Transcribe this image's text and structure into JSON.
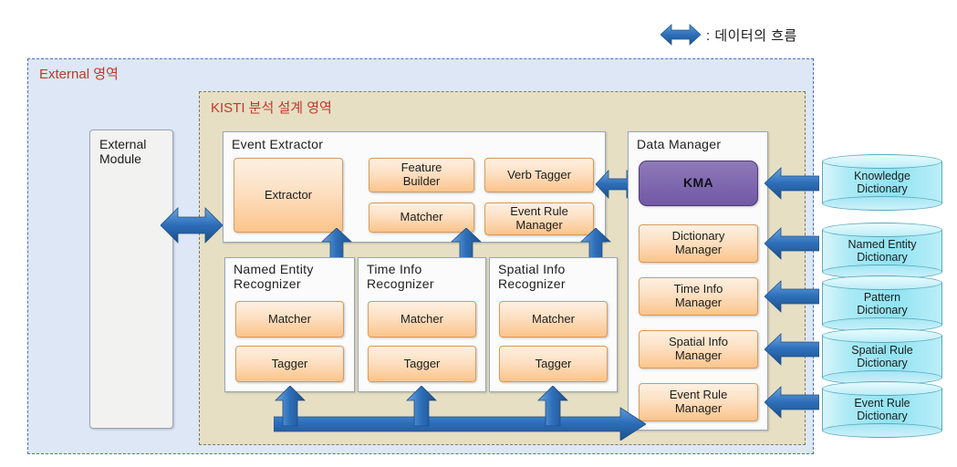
{
  "legend": {
    "icon": "double-headed-arrow-icon",
    "text": ": 데이터의 흐름"
  },
  "regions": {
    "external": {
      "label": "External 영역",
      "fill": "#dde7f5",
      "border": "#4a72b8"
    },
    "kisti": {
      "label": "KISTI 분석 설계 영역",
      "fill": "#e6dfc4",
      "border": "#7a7a6a"
    }
  },
  "colors": {
    "orange_box": "#fbc48b",
    "purple_box": "#7158a5",
    "cylinder": "#8fe3f2",
    "arrow_blue": "#2e6fba",
    "label_red": "#c0392b"
  },
  "external_module": {
    "label": "External\nModule",
    "line1": "External",
    "line2": "Module"
  },
  "panels": {
    "event_extractor": {
      "title": "Event  Extractor",
      "boxes": [
        {
          "label": "Extractor"
        },
        {
          "line1": "Feature",
          "line2": "Builder"
        },
        {
          "line1": "Verb Tagger",
          "line2": ""
        },
        {
          "line1": "Matcher",
          "line2": ""
        },
        {
          "line1": "Event Rule",
          "line2": "Manager"
        }
      ]
    },
    "named_entity_recognizer": {
      "title_line1": "Named  Entity",
      "title_line2": "Recognizer",
      "boxes": [
        {
          "label": "Matcher"
        },
        {
          "label": "Tagger"
        }
      ]
    },
    "time_info_recognizer": {
      "title_line1": "Time Info",
      "title_line2": "Recognizer",
      "boxes": [
        {
          "label": "Matcher"
        },
        {
          "label": "Tagger"
        }
      ]
    },
    "spatial_info_recognizer": {
      "title_line1": "Spatial Info",
      "title_line2": "Recognizer",
      "boxes": [
        {
          "label": "Matcher"
        },
        {
          "label": "Tagger"
        }
      ]
    },
    "data_manager": {
      "title": "Data Manager",
      "boxes": [
        {
          "label": "KMA",
          "kind": "kma"
        },
        {
          "line1": "Dictionary",
          "line2": "Manager"
        },
        {
          "line1": "Time Info",
          "line2": "Manager"
        },
        {
          "line1": "Spatial Info",
          "line2": "Manager"
        },
        {
          "line1": "Event Rule",
          "line2": "Manager"
        }
      ]
    }
  },
  "dictionaries": [
    {
      "line1": "Knowledge",
      "line2": "Dictionary"
    },
    {
      "line1": "Named Entity",
      "line2": "Dictionary"
    },
    {
      "line1": "Pattern",
      "line2": "Dictionary"
    },
    {
      "line1": "Spatial Rule",
      "line2": "Dictionary"
    },
    {
      "line1": "Event Rule",
      "line2": "Dictionary"
    }
  ]
}
